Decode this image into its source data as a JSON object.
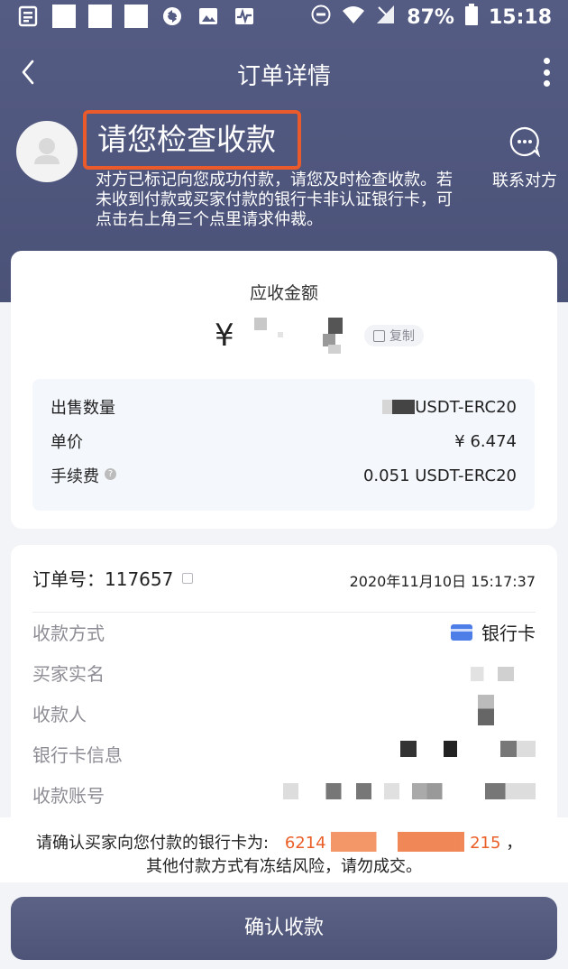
{
  "status_bar": {
    "battery_percent": "87%",
    "time": "15:18"
  },
  "nav": {
    "title": "订单详情"
  },
  "header": {
    "headline": "请您检查收款",
    "description": "对方已标记向您成功付款，请您及时检查收款。若未收到付款或买家付款的银行卡非认证银行卡，可点击右上角三个点里请求仲裁。",
    "contact_label": "联系对方"
  },
  "amount_card": {
    "label": "应收金额",
    "currency": "¥",
    "copy_label": "复制",
    "rows": [
      {
        "label": "出售数量",
        "value": "USDT-ERC20"
      },
      {
        "label": "单价",
        "value": "¥ 6.474"
      },
      {
        "label": "手续费",
        "value": "0.051 USDT-ERC20"
      }
    ]
  },
  "order_card": {
    "order_label": "订单号：",
    "order_no": "117657",
    "time": "2020年11月10日 15:17:37",
    "payment_method_label": "收款方式",
    "payment_method_value": "银行卡",
    "buyer_name_label": "买家实名",
    "payee_label": "收款人",
    "bank_info_label": "银行卡信息",
    "account_label": "收款账号"
  },
  "notice": {
    "line1_prefix": "请确认买家向您付款的银行卡为:",
    "card_start": "6214",
    "card_end": "215",
    "line1_suffix": "，",
    "line2": "其他付款方式有冻结风险，请勿成交。"
  },
  "confirm_button": {
    "label": "确认收款"
  }
}
